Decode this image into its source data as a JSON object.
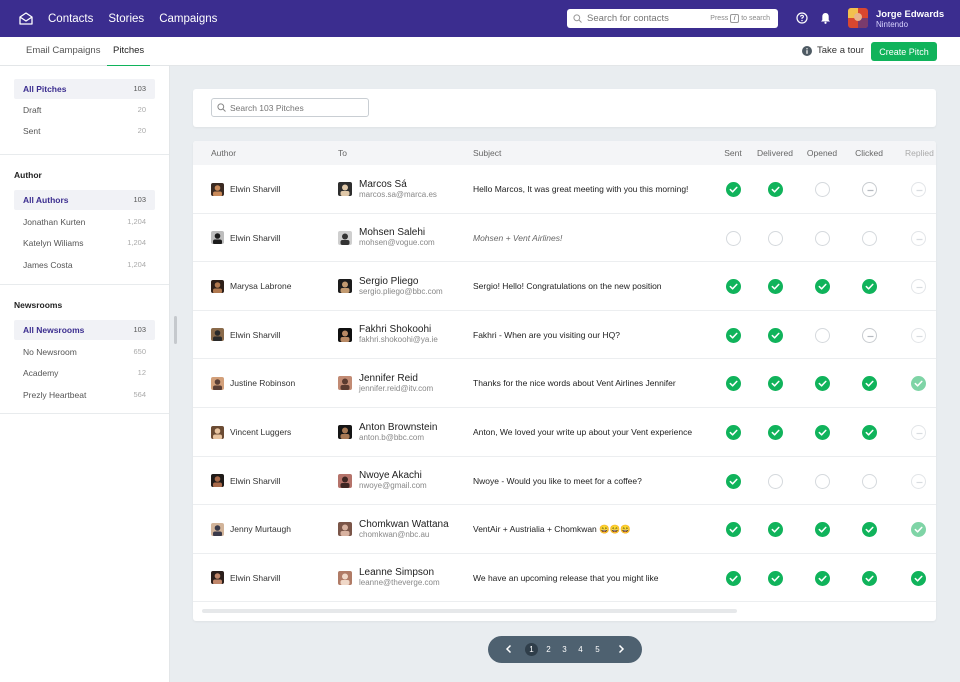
{
  "topnav": {
    "links": [
      "Contacts",
      "Stories",
      "Campaigns"
    ],
    "search_placeholder": "Search for contacts",
    "search_hint_pre": "Press",
    "search_hint_key": "/",
    "search_hint_post": "to search",
    "user_name": "Jorge Edwards",
    "user_org": "Nintendo"
  },
  "subnav": {
    "tabs": [
      "Email Campaigns",
      "Pitches"
    ],
    "active_tab": "Pitches",
    "tour_label": "Take a tour",
    "create_label": "Create Pitch"
  },
  "sidebar": {
    "status": [
      {
        "label": "All Pitches",
        "count": "103"
      },
      {
        "label": "Draft",
        "count": "20"
      },
      {
        "label": "Sent",
        "count": "20"
      }
    ],
    "author_head": "Author",
    "authors": [
      {
        "label": "All Authors",
        "count": "103"
      },
      {
        "label": "Jonathan Kurten",
        "count": "1,204"
      },
      {
        "label": "Katelyn Wiliams",
        "count": "1,204"
      },
      {
        "label": "James Costa",
        "count": "1,204"
      }
    ],
    "newsroom_head": "Newsrooms",
    "newsrooms": [
      {
        "label": "All Newsrooms",
        "count": "103"
      },
      {
        "label": "No Newsroom",
        "count": "650"
      },
      {
        "label": "Academy",
        "count": "12"
      },
      {
        "label": "Prezly Heartbeat",
        "count": "564"
      }
    ]
  },
  "filter": {
    "placeholder": "Search 103 Pitches"
  },
  "table": {
    "headers": {
      "author": "Author",
      "to": "To",
      "subject": "Subject",
      "sent": "Sent",
      "delivered": "Delivered",
      "opened": "Opened",
      "clicked": "Clicked",
      "replied": "Replied"
    },
    "rows": [
      {
        "author": "Elwin Sharvill",
        "to_name": "Marcos Sá",
        "to_email": "marcos.sa@marca.es",
        "subject": "Hello Marcos, It was great meeting with you this morning!",
        "italic": false,
        "status": [
          "done",
          "done",
          "empty",
          "dash",
          "dash-faded"
        ]
      },
      {
        "author": "Elwin Sharvill",
        "to_name": "Mohsen Salehi",
        "to_email": "mohsen@vogue.com",
        "subject": "Mohsen + Vent Airlines!",
        "italic": true,
        "status": [
          "empty",
          "empty",
          "empty",
          "empty",
          "dash-faded"
        ]
      },
      {
        "author": "Marysa Labrone",
        "to_name": "Sergio Pliego",
        "to_email": "sergio.pliego@bbc.com",
        "subject": "Sergio! Hello! Congratulations on the new position",
        "italic": false,
        "status": [
          "done",
          "done",
          "done",
          "done",
          "dash-faded"
        ]
      },
      {
        "author": "Elwin Sharvill",
        "to_name": "Fakhri Shokoohi",
        "to_email": "fakhri.shokoohi@ya.ie",
        "subject": "Fakhri - When are you visiting our HQ?",
        "italic": false,
        "status": [
          "done",
          "done",
          "empty",
          "dash",
          "dash-faded"
        ]
      },
      {
        "author": "Justine Robinson",
        "to_name": "Jennifer Reid",
        "to_email": "jennifer.reid@itv.com",
        "subject": "Thanks for the nice words about Vent Airlines Jennifer",
        "italic": false,
        "status": [
          "done",
          "done",
          "done",
          "done",
          "done-faded"
        ]
      },
      {
        "author": "Vincent Luggers",
        "to_name": "Anton Brownstein",
        "to_email": "anton.b@bbc.com",
        "subject": "Anton, We loved your write up about your Vent experience",
        "italic": false,
        "status": [
          "done",
          "done",
          "done",
          "done",
          "dash-faded"
        ]
      },
      {
        "author": "Elwin Sharvill",
        "to_name": "Nwoye Akachi",
        "to_email": "nwoye@gmail.com",
        "subject": "Nwoye - Would you like to meet for a coffee?",
        "italic": false,
        "status": [
          "done",
          "empty",
          "empty",
          "empty",
          "dash-faded"
        ]
      },
      {
        "author": "Jenny Murtaugh",
        "to_name": "Chomkwan Wattana",
        "to_email": "chomkwan@nbc.au",
        "subject": "VentAir + Austrialia + Chomkwan 😄😄😄",
        "italic": false,
        "status": [
          "done",
          "done",
          "done",
          "done",
          "done-faded"
        ]
      },
      {
        "author": "Elwin Sharvill",
        "to_name": "Leanne Simpson",
        "to_email": "leanne@theverge.com",
        "subject": "We have an upcoming release that you might like",
        "italic": false,
        "status": [
          "done",
          "done",
          "done",
          "done",
          "done"
        ]
      }
    ]
  },
  "pagination": {
    "pages": [
      "1",
      "2",
      "3",
      "4",
      "5"
    ],
    "active": "1"
  },
  "colors": {
    "nav": "#3b2d8f",
    "accent": "#10b35b",
    "pager": "#4e6170"
  }
}
